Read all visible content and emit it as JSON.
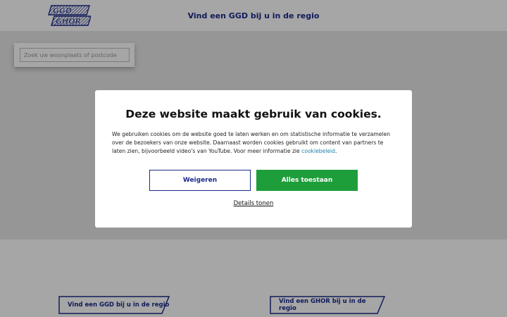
{
  "header": {
    "logo_text": "GGD GHOR",
    "title": "Vind een GGD bij u in de regio"
  },
  "search": {
    "placeholder": "Zoek uw woonplaats of postcode",
    "value": ""
  },
  "cookie_modal": {
    "title": "Deze website maakt gebruik van cookies.",
    "body_text": "We gebruiken cookies om de website goed te laten werken en om statistische informatie te verzamelen over de bezoekers van onze website. Daarnaast worden cookies gebruikt om content van partners te laten zien, bijvoorbeeld video's van YouTube. Voor meer informatie zie ",
    "link_label": "cookiebeleid",
    "body_end": ".",
    "refuse_label": "Weigeren",
    "accept_label": "Alles toestaan",
    "details_label": "Details tonen"
  },
  "links": {
    "ggd_label": "Vind een GGD bij u in de regio",
    "ghor_label": "Vind een GHOR bij u in de regio"
  },
  "colors": {
    "brand_navy": "#1a2a8a",
    "accept_green": "#1e9e3a",
    "link_blue": "#1a7fa8"
  }
}
